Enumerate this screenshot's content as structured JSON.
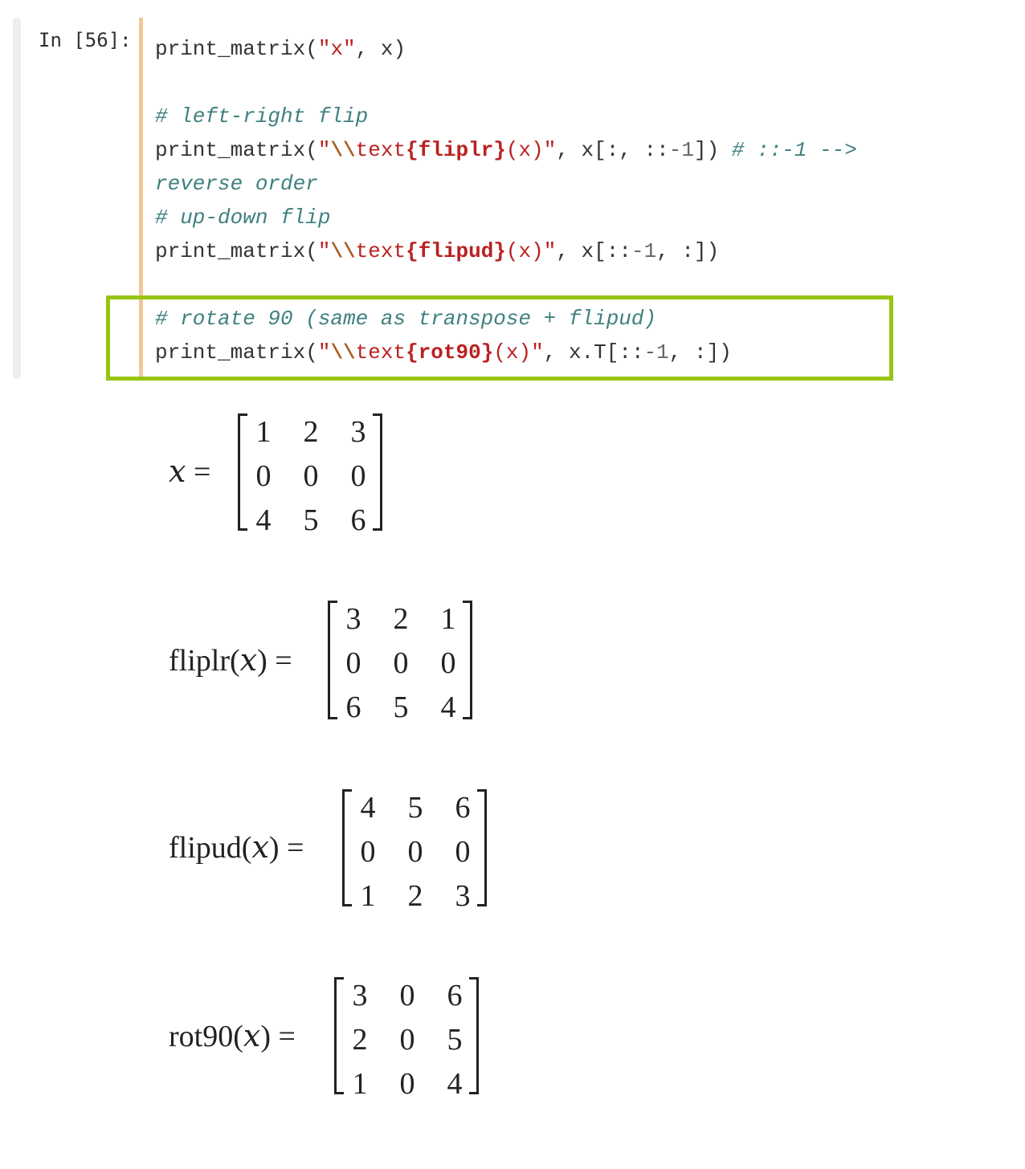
{
  "prompt": "In [56]:",
  "code_lines": [
    [
      {
        "t": "print_matrix(",
        "c": ""
      },
      {
        "t": "\"x\"",
        "c": "str"
      },
      {
        "t": ", x)",
        "c": ""
      }
    ],
    [],
    [
      {
        "t": "# left-right flip",
        "c": "cmt"
      }
    ],
    [
      {
        "t": "print_matrix(",
        "c": ""
      },
      {
        "t": "\"",
        "c": "str"
      },
      {
        "t": "\\\\",
        "c": "esc"
      },
      {
        "t": "text",
        "c": "str"
      },
      {
        "t": "{fliplr}",
        "c": "bold"
      },
      {
        "t": "(x)\"",
        "c": "str"
      },
      {
        "t": ", x[:, ::",
        "c": ""
      },
      {
        "t": "-1",
        "c": "op"
      },
      {
        "t": "]) ",
        "c": ""
      },
      {
        "t": "# ::-1 -->",
        "c": "cmt"
      }
    ],
    [
      {
        "t": "reverse order",
        "c": "cmt"
      }
    ],
    [
      {
        "t": "# up-down flip",
        "c": "cmt"
      }
    ],
    [
      {
        "t": "print_matrix(",
        "c": ""
      },
      {
        "t": "\"",
        "c": "str"
      },
      {
        "t": "\\\\",
        "c": "esc"
      },
      {
        "t": "text",
        "c": "str"
      },
      {
        "t": "{flipud}",
        "c": "bold"
      },
      {
        "t": "(x)\"",
        "c": "str"
      },
      {
        "t": ", x[::",
        "c": ""
      },
      {
        "t": "-1",
        "c": "op"
      },
      {
        "t": ", :])",
        "c": ""
      }
    ],
    [],
    [
      {
        "t": "# rotate 90 (same as transpose + flipud)",
        "c": "cmt"
      }
    ],
    [
      {
        "t": "print_matrix(",
        "c": ""
      },
      {
        "t": "\"",
        "c": "str"
      },
      {
        "t": "\\\\",
        "c": "esc"
      },
      {
        "t": "text",
        "c": "str"
      },
      {
        "t": "{rot90}",
        "c": "bold"
      },
      {
        "t": "(x)\"",
        "c": "str"
      },
      {
        "t": ", x.T[::",
        "c": ""
      },
      {
        "t": "-1",
        "c": "op"
      },
      {
        "t": ", :])",
        "c": ""
      }
    ]
  ],
  "outputs": [
    {
      "name": "x",
      "func": "",
      "rows": [
        [
          "1",
          "2",
          "3"
        ],
        [
          "0",
          "0",
          "0"
        ],
        [
          "4",
          "5",
          "6"
        ]
      ]
    },
    {
      "name": "x",
      "func": "fliplr",
      "rows": [
        [
          "3",
          "2",
          "1"
        ],
        [
          "0",
          "0",
          "0"
        ],
        [
          "6",
          "5",
          "4"
        ]
      ]
    },
    {
      "name": "x",
      "func": "flipud",
      "rows": [
        [
          "4",
          "5",
          "6"
        ],
        [
          "0",
          "0",
          "0"
        ],
        [
          "1",
          "2",
          "3"
        ]
      ]
    },
    {
      "name": "x",
      "func": "rot90",
      "rows": [
        [
          "3",
          "0",
          "6"
        ],
        [
          "2",
          "0",
          "5"
        ],
        [
          "1",
          "0",
          "4"
        ]
      ]
    }
  ],
  "colors": {
    "highlight": "#98c414",
    "cell_border": "#f2c89a"
  }
}
